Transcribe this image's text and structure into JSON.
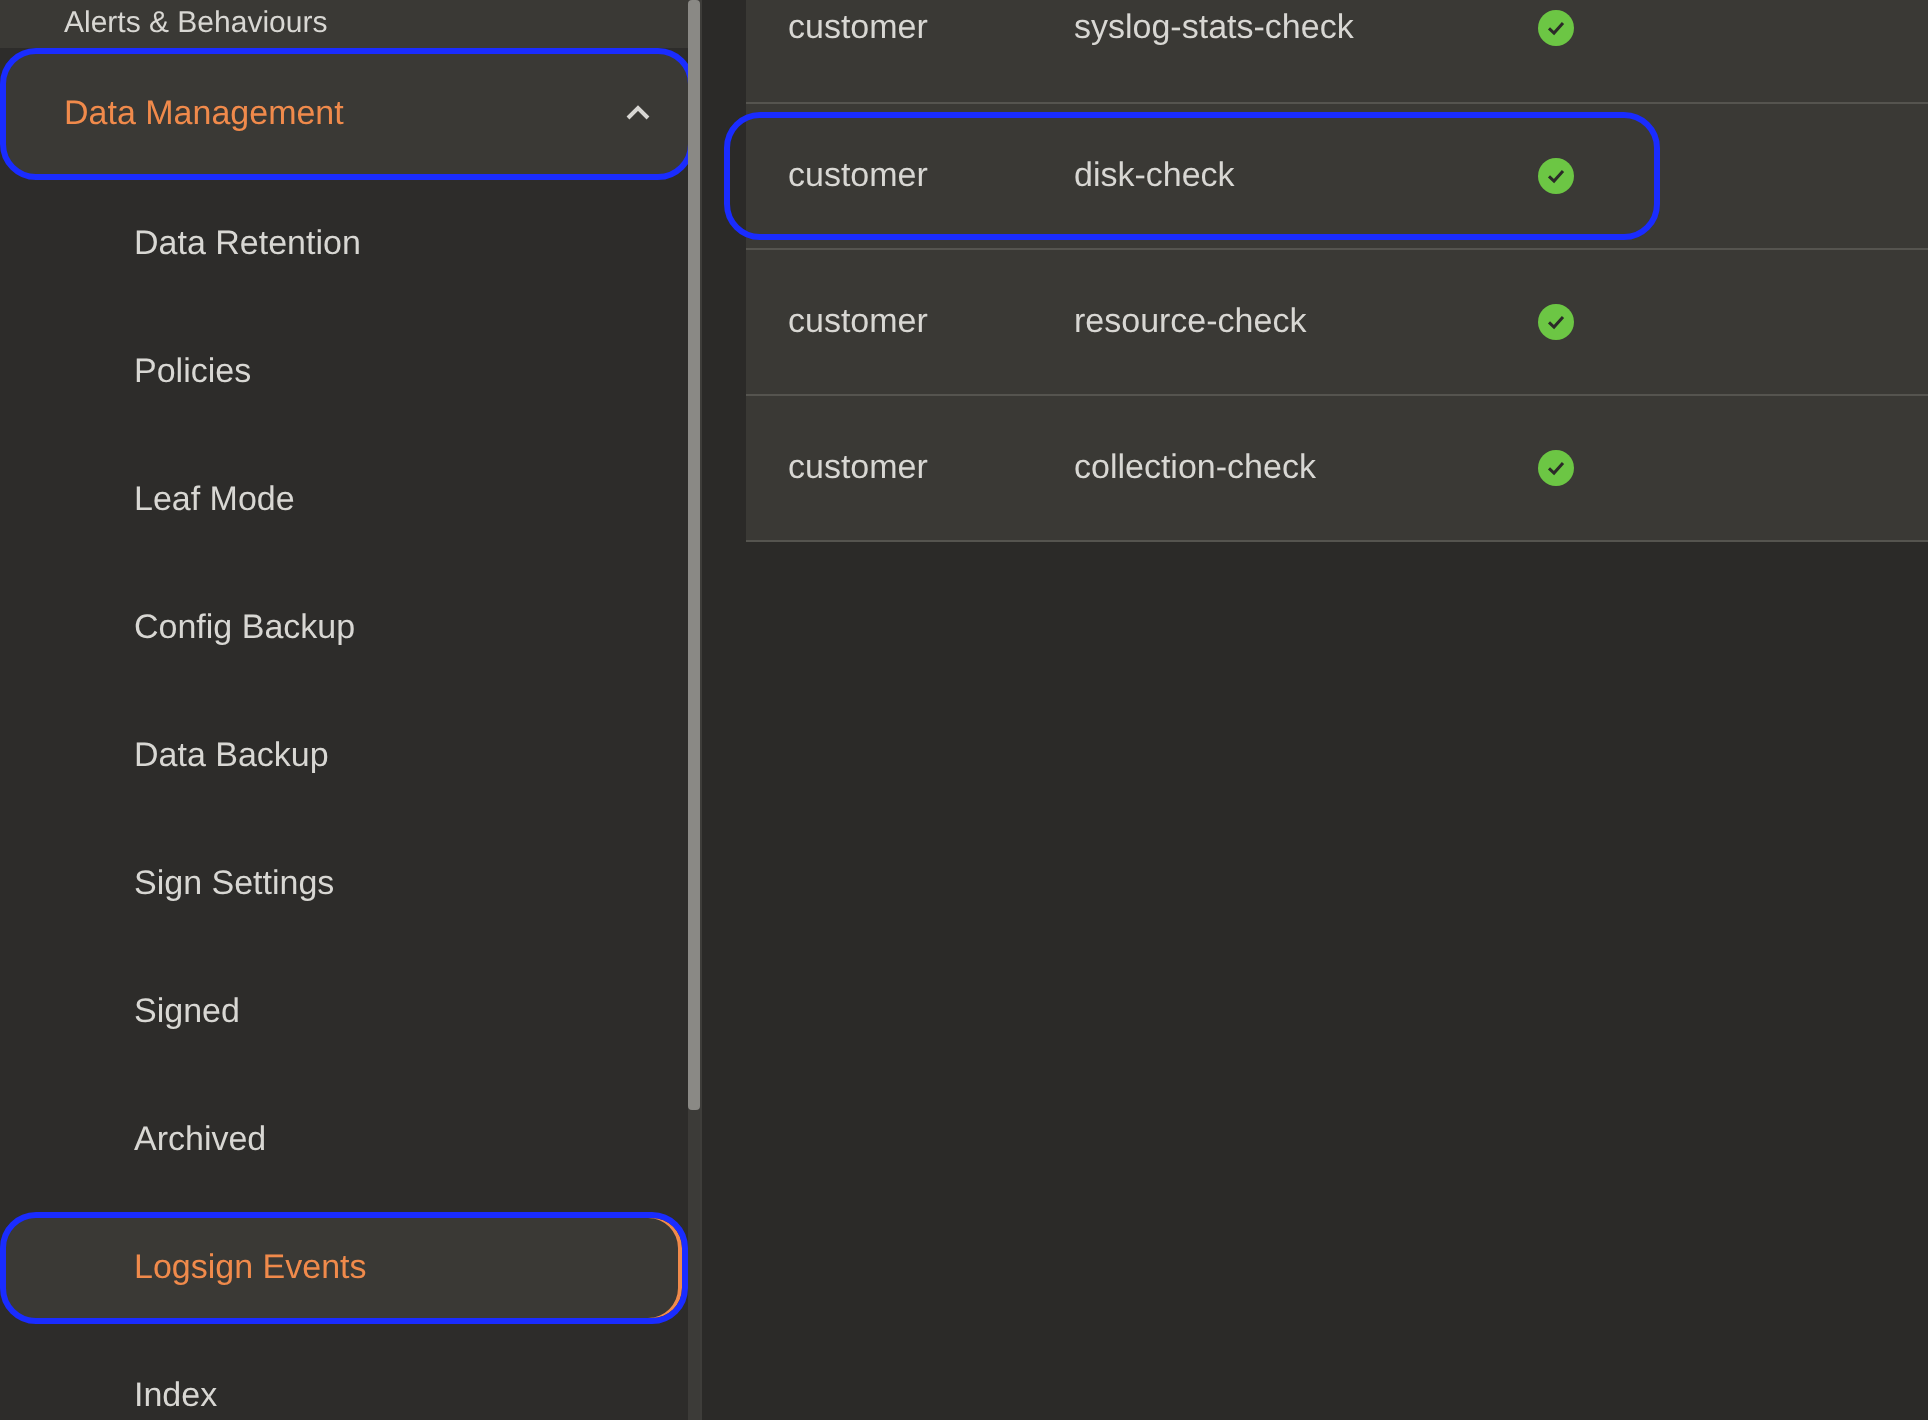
{
  "sidebar": {
    "top_item": {
      "label": "Alerts & Behaviours"
    },
    "group": {
      "label": "Data Management",
      "expanded": true,
      "highlighted": true,
      "children": [
        {
          "label": "Data Retention",
          "selected": false,
          "highlighted": false
        },
        {
          "label": "Policies",
          "selected": false,
          "highlighted": false
        },
        {
          "label": "Leaf Mode",
          "selected": false,
          "highlighted": false
        },
        {
          "label": "Config Backup",
          "selected": false,
          "highlighted": false
        },
        {
          "label": "Data Backup",
          "selected": false,
          "highlighted": false
        },
        {
          "label": "Sign Settings",
          "selected": false,
          "highlighted": false
        },
        {
          "label": "Signed",
          "selected": false,
          "highlighted": false
        },
        {
          "label": "Archived",
          "selected": false,
          "highlighted": false
        },
        {
          "label": "Logsign Events",
          "selected": true,
          "highlighted": true
        },
        {
          "label": "Index",
          "selected": false,
          "highlighted": false
        }
      ]
    }
  },
  "table": {
    "rows": [
      {
        "column_1": "customer",
        "column_2": "syslog-stats-check",
        "ok": true,
        "highlighted": false
      },
      {
        "column_1": "customer",
        "column_2": "disk-check",
        "ok": true,
        "highlighted": true
      },
      {
        "column_1": "customer",
        "column_2": "resource-check",
        "ok": true,
        "highlighted": false
      },
      {
        "column_1": "customer",
        "column_2": "collection-check",
        "ok": true,
        "highlighted": false
      }
    ]
  }
}
